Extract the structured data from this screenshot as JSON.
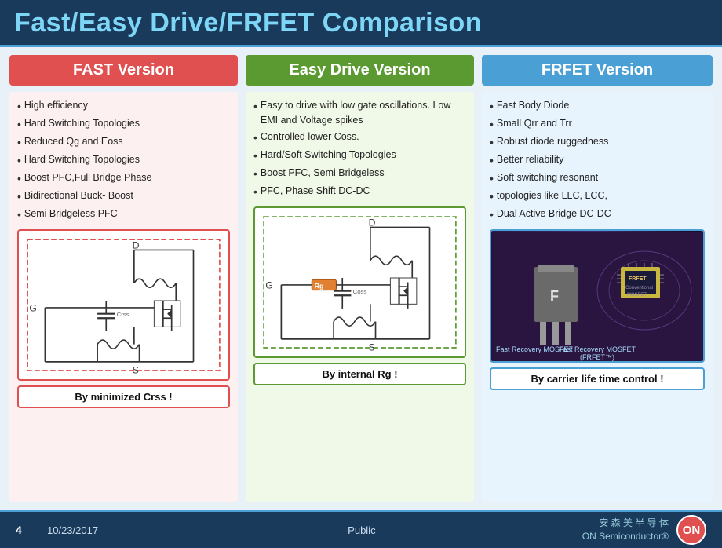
{
  "header": {
    "title": "Fast/Easy Drive/FRFET Comparison"
  },
  "columns": {
    "fast": {
      "header": "FAST Version",
      "bullets": [
        "High efficiency",
        "Hard Switching Topologies",
        "Reduced Qg and Eoss",
        "Hard Switching Topologies",
        "Boost PFC,Full Bridge Phase",
        " Bidirectional Buck- Boost",
        "Semi Bridgeless PFC"
      ],
      "caption": "By minimized Crss !"
    },
    "easy": {
      "header": "Easy Drive Version",
      "bullets": [
        "Easy to drive with low gate oscillations. Low EMI and Voltage spikes",
        "Controlled lower Coss.",
        "Hard/Soft Switching Topologies",
        "Boost PFC, Semi Bridgeless",
        "PFC, Phase Shift DC-DC"
      ],
      "caption": "By internal Rg !"
    },
    "frfet": {
      "header": "FRFET Version",
      "bullets": [
        "Fast Body Diode",
        "Small Qrr and Trr",
        "Robust diode ruggedness",
        "Better reliability",
        "Soft  switching resonant",
        "topologies like LLC, LCC,",
        "Dual Active Bridge DC-DC"
      ],
      "caption": "By carrier life time control !"
    }
  },
  "footer": {
    "page": "4",
    "date": "10/23/2017",
    "classification": "Public",
    "brand_line1": "安 森 美 半 导 体",
    "brand_line2": "ON Semiconductor®",
    "logo": "ON"
  }
}
